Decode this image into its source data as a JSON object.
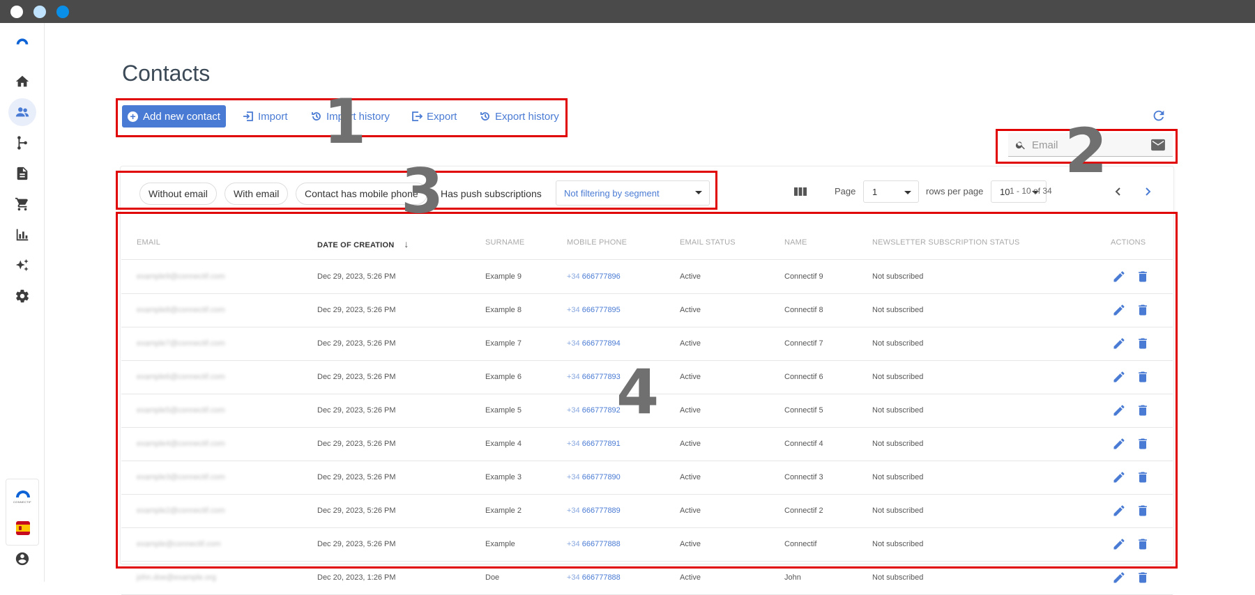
{
  "colors": {
    "accent": "#4a7bd4",
    "annotation": "#e00000",
    "titlebar": "#4a4a4a"
  },
  "window": {
    "dots": [
      "#ffffff",
      "#bfe3ff",
      "#0a8fe8"
    ]
  },
  "sidebar": {
    "items": [
      {
        "icon": "brand-logo-icon"
      },
      {
        "icon": "home-icon"
      },
      {
        "icon": "contacts-icon",
        "active": true
      },
      {
        "icon": "flow-icon"
      },
      {
        "icon": "document-icon"
      },
      {
        "icon": "cart-icon"
      },
      {
        "icon": "bar-chart-icon"
      },
      {
        "icon": "sparkle-icon"
      },
      {
        "icon": "settings-icon"
      }
    ],
    "bottom": {
      "brand_label": "CONNECTIF",
      "language_icon": "spain-flag-icon",
      "account_icon": "account-icon"
    }
  },
  "page": {
    "title": "Contacts"
  },
  "toolbar": {
    "add_label": "Add new contact",
    "import_label": "Import",
    "import_history_label": "Import history",
    "export_label": "Export",
    "export_history_label": "Export history"
  },
  "search": {
    "placeholder": "Email"
  },
  "filters": {
    "chips": [
      "Without email",
      "With email",
      "Contact has mobile phone",
      "Has push subscriptions"
    ],
    "segment_value": "Not filtering by segment"
  },
  "pagination": {
    "page_label": "Page",
    "page_value": "1",
    "rows_label": "rows per page",
    "rows_value": "10",
    "range": "1 - 10 of 34"
  },
  "table": {
    "columns": [
      "Email",
      "Date of creation",
      "Surname",
      "Mobile phone",
      "Email status",
      "Name",
      "Newsletter subscription status",
      "Actions"
    ],
    "sorted_column": "Date of creation",
    "rows": [
      {
        "email": "example9@connectif.com",
        "date": "Dec 29, 2023, 5:26 PM",
        "surname": "Example 9",
        "cc": "+34",
        "phone": "666777896",
        "status": "Active",
        "name": "Connectif 9",
        "newsletter": "Not subscribed"
      },
      {
        "email": "example8@connectif.com",
        "date": "Dec 29, 2023, 5:26 PM",
        "surname": "Example 8",
        "cc": "+34",
        "phone": "666777895",
        "status": "Active",
        "name": "Connectif 8",
        "newsletter": "Not subscribed"
      },
      {
        "email": "example7@connectif.com",
        "date": "Dec 29, 2023, 5:26 PM",
        "surname": "Example 7",
        "cc": "+34",
        "phone": "666777894",
        "status": "Active",
        "name": "Connectif 7",
        "newsletter": "Not subscribed"
      },
      {
        "email": "example6@connectif.com",
        "date": "Dec 29, 2023, 5:26 PM",
        "surname": "Example 6",
        "cc": "+34",
        "phone": "666777893",
        "status": "Active",
        "name": "Connectif 6",
        "newsletter": "Not subscribed"
      },
      {
        "email": "example5@connectif.com",
        "date": "Dec 29, 2023, 5:26 PM",
        "surname": "Example 5",
        "cc": "+34",
        "phone": "666777892",
        "status": "Active",
        "name": "Connectif 5",
        "newsletter": "Not subscribed"
      },
      {
        "email": "example4@connectif.com",
        "date": "Dec 29, 2023, 5:26 PM",
        "surname": "Example 4",
        "cc": "+34",
        "phone": "666777891",
        "status": "Active",
        "name": "Connectif 4",
        "newsletter": "Not subscribed"
      },
      {
        "email": "example3@connectif.com",
        "date": "Dec 29, 2023, 5:26 PM",
        "surname": "Example 3",
        "cc": "+34",
        "phone": "666777890",
        "status": "Active",
        "name": "Connectif 3",
        "newsletter": "Not subscribed"
      },
      {
        "email": "example2@connectif.com",
        "date": "Dec 29, 2023, 5:26 PM",
        "surname": "Example 2",
        "cc": "+34",
        "phone": "666777889",
        "status": "Active",
        "name": "Connectif 2",
        "newsletter": "Not subscribed"
      },
      {
        "email": "example@connectif.com",
        "date": "Dec 29, 2023, 5:26 PM",
        "surname": "Example",
        "cc": "+34",
        "phone": "666777888",
        "status": "Active",
        "name": "Connectif",
        "newsletter": "Not subscribed"
      },
      {
        "email": "john.doe@example.org",
        "date": "Dec 20, 2023, 1:26 PM",
        "surname": "Doe",
        "cc": "+34",
        "phone": "666777888",
        "status": "Active",
        "name": "John",
        "newsletter": "Not subscribed"
      }
    ]
  },
  "annotations": {
    "labels": [
      "1",
      "2",
      "3",
      "4"
    ]
  }
}
